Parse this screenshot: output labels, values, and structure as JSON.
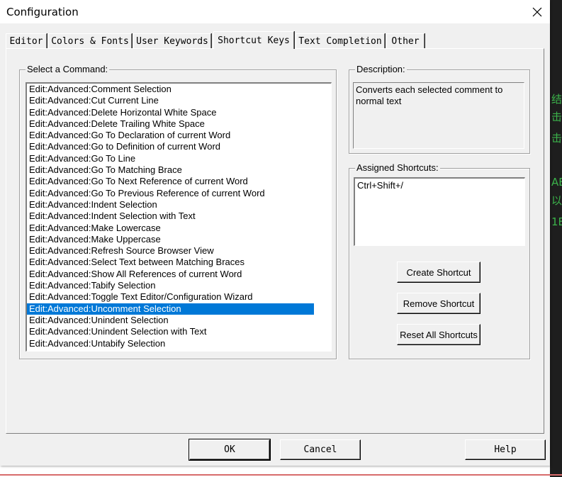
{
  "window": {
    "title": "Configuration"
  },
  "tabs": [
    {
      "label": "Editor",
      "active": false
    },
    {
      "label": "Colors & Fonts",
      "active": false
    },
    {
      "label": "User Keywords",
      "active": false
    },
    {
      "label": "Shortcut Keys",
      "active": true
    },
    {
      "label": "Text Completion",
      "active": false
    },
    {
      "label": "Other",
      "active": false
    }
  ],
  "commands": {
    "group_label": "Select a Command:",
    "items": [
      "Edit:Advanced:Comment Selection",
      "Edit:Advanced:Cut Current Line",
      "Edit:Advanced:Delete Horizontal White Space",
      "Edit:Advanced:Delete Trailing White Space",
      "Edit:Advanced:Go To Declaration of current Word",
      "Edit:Advanced:Go to Definition of current Word",
      "Edit:Advanced:Go To Line",
      "Edit:Advanced:Go To Matching Brace",
      "Edit:Advanced:Go To Next Reference of current Word",
      "Edit:Advanced:Go To Previous Reference of current Word",
      "Edit:Advanced:Indent Selection",
      "Edit:Advanced:Indent Selection with Text",
      "Edit:Advanced:Make Lowercase",
      "Edit:Advanced:Make Uppercase",
      "Edit:Advanced:Refresh Source Browser View",
      "Edit:Advanced:Select Text between Matching Braces",
      "Edit:Advanced:Show All References of current Word",
      "Edit:Advanced:Tabify Selection",
      "Edit:Advanced:Toggle Text Editor/Configuration Wizard",
      "Edit:Advanced:Uncomment Selection",
      "Edit:Advanced:Unindent Selection",
      "Edit:Advanced:Unindent Selection with Text",
      "Edit:Advanced:Untabify Selection"
    ],
    "selected_index": 19
  },
  "description": {
    "group_label": "Description:",
    "text": "Converts each selected comment to normal text"
  },
  "shortcuts": {
    "group_label": "Assigned Shortcuts:",
    "items": [
      "Ctrl+Shift+/"
    ],
    "create_label": "Create Shortcut",
    "remove_label": "Remove Shortcut",
    "reset_label": "Reset All Shortcuts"
  },
  "footer": {
    "ok_label": "OK",
    "cancel_label": "Cancel",
    "help_label": "Help"
  },
  "background_glyphs": [
    "结",
    "击",
    "击",
    "",
    "AE",
    "以",
    "1E"
  ],
  "colors": {
    "selection": "#0078d7",
    "dialog_face": "#f0f0f0"
  }
}
